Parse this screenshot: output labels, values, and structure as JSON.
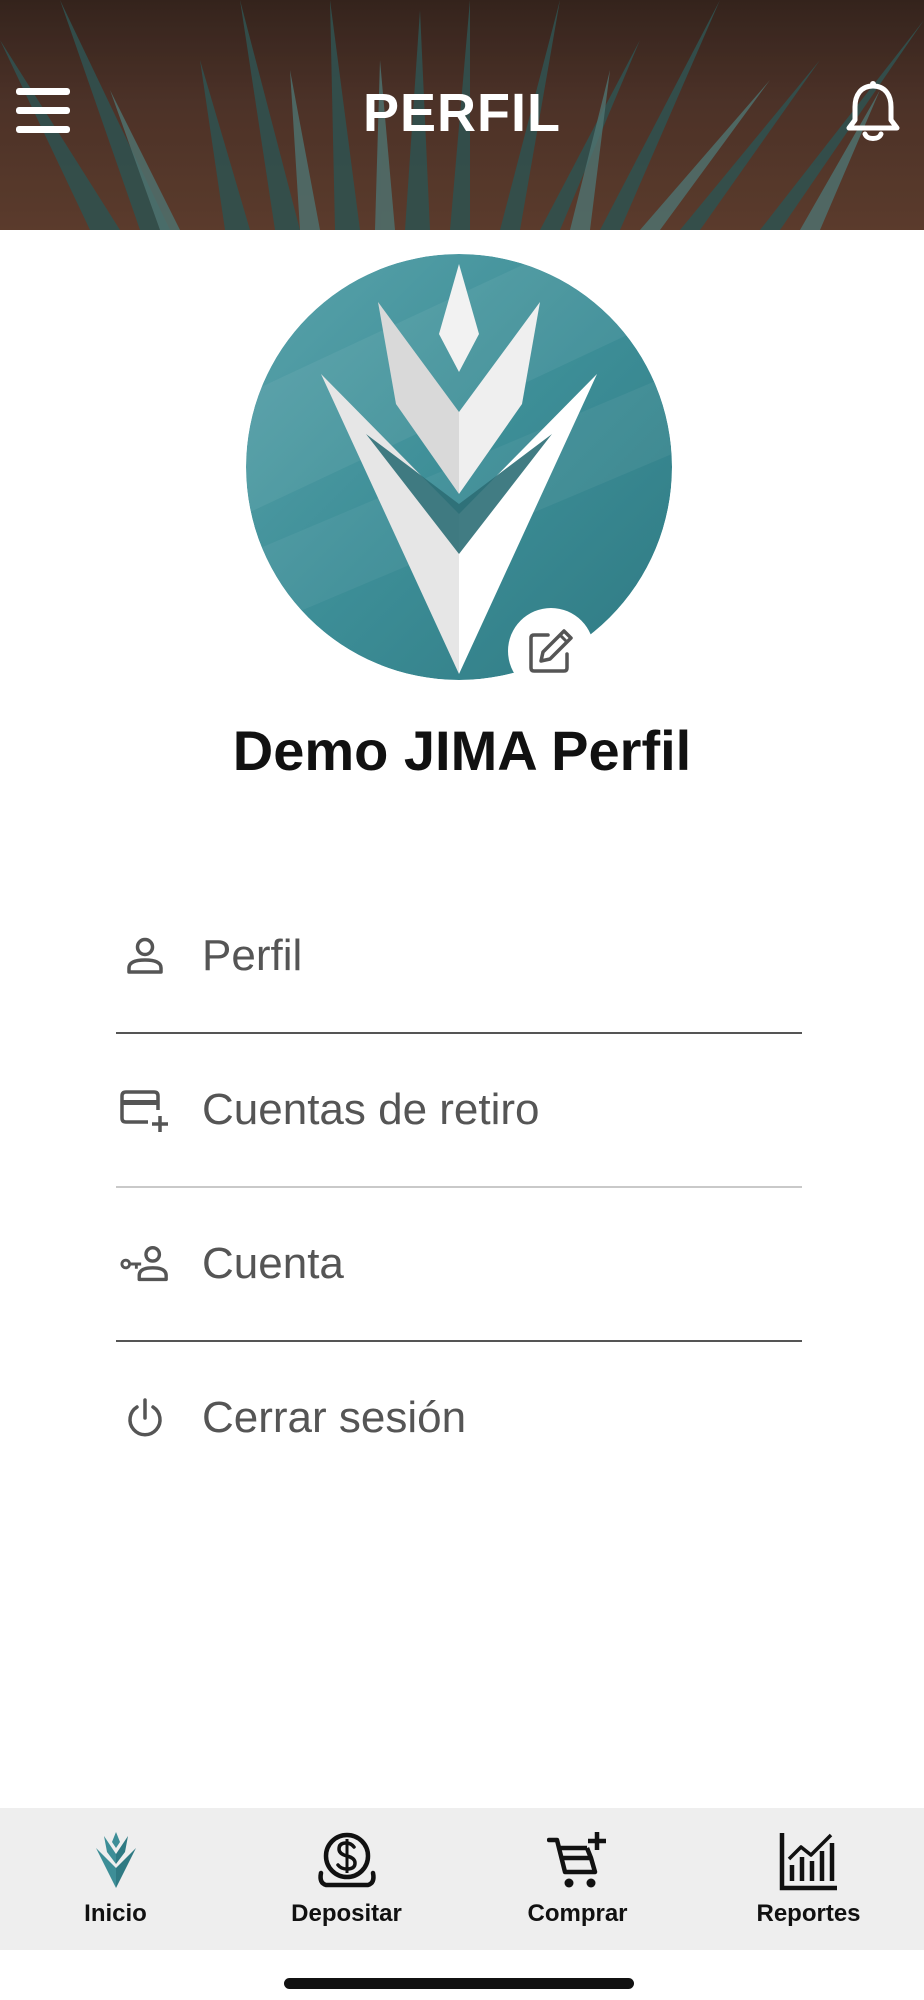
{
  "header": {
    "title": "PERFIL"
  },
  "profile": {
    "name": "Demo JIMA Perfil"
  },
  "menu": {
    "items": [
      {
        "label": "Perfil",
        "icon": "person-icon"
      },
      {
        "label": "Cuentas de retiro",
        "icon": "card-plus-icon"
      },
      {
        "label": "Cuenta",
        "icon": "key-person-icon"
      },
      {
        "label": "Cerrar sesión",
        "icon": "power-icon"
      }
    ]
  },
  "bottom_nav": {
    "items": [
      {
        "label": "Inicio",
        "icon": "agave-logo-icon"
      },
      {
        "label": "Depositar",
        "icon": "dollar-coin-icon"
      },
      {
        "label": "Comprar",
        "icon": "cart-plus-icon"
      },
      {
        "label": "Reportes",
        "icon": "bar-chart-icon"
      }
    ]
  },
  "colors": {
    "brand_teal": "#3d8e97",
    "text_dark": "#111111",
    "text_muted": "#555555",
    "nav_bg": "#eeeeee"
  }
}
